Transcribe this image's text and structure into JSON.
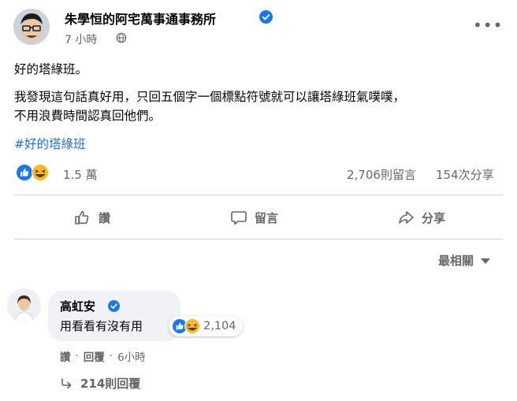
{
  "post": {
    "page_name": "朱學恒的阿宅萬事通事務所",
    "timestamp": "7 小時",
    "more_label": "•••",
    "text_lines": [
      "好的塔綠班。",
      "我發現這句話真好用，只回五個字一個標點符號就可以讓塔綠班氣噗噗，",
      "不用浪費時間認真回他們。"
    ],
    "hashtag": "#好的塔綠班",
    "reactions_count": "1.5 萬",
    "comments_count": "2,706則留言",
    "shares_count": "154次分享"
  },
  "actions": {
    "like_label": "讚",
    "comment_label": "留言",
    "share_label": "分享"
  },
  "sort": {
    "label": "最相關"
  },
  "comment": {
    "author": "高虹安",
    "text": "用看看有沒有用",
    "reactions_count": "2,104",
    "like_label": "讚",
    "separator": "·",
    "reply_label": "回覆",
    "timestamp": "6小時",
    "replies_label": "214則回覆"
  },
  "colors": {
    "link_blue": "#216fdb",
    "like_blue": "#1877f2",
    "haha_yellow": "#f7b928",
    "secondary_text": "#65676b"
  }
}
